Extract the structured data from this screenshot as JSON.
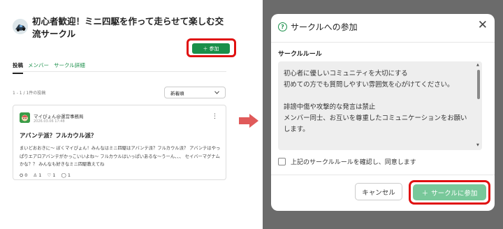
{
  "left": {
    "circle_title": "初心者歓迎！ミニ四駆を作って走らせて楽しむ交流サークル",
    "join_button": {
      "icon": "＋",
      "label": "参加"
    },
    "tabs": [
      {
        "label": "投稿",
        "active": true
      },
      {
        "label": "メンバー",
        "active": false
      },
      {
        "label": "サークル詳細",
        "active": false
      }
    ],
    "post_count": "1 - 1 / 1件の投稿",
    "sort": {
      "selected": "新着順"
    },
    "post": {
      "author": "マイぴょん@運営事務局",
      "date": "2026.03.06 17:48",
      "title": "アバンテ派？フルカウル派？",
      "body": "まいどおおきに〜 ぼくマイぴょん！みんなはミニ四駆はアバンテ派？フルカウル派？ アバンテはやっぱりエアロアバンテがかっこいいよね〜 フルカウルはいっぱいあるな〜うーん、、、 セイバーマグナムかな？？ みんなも好きなミニ四駆教えてね",
      "stats": {
        "views": "0",
        "comments": "1",
        "likes": "1",
        "replies": "1"
      }
    }
  },
  "modal": {
    "title": "サークルへの参加",
    "rules_label": "サークルルール",
    "rules_text": "初心者に優しいコミュニティを大切にする\n初めての方でも質問しやすい雰囲気を心がけてください。\n\n誹謗中傷や攻撃的な発言は禁止\nメンバー同士、お互いを尊重したコミュニケーションをお願いします。",
    "agree_label": "上記のサークルルールを確認し、同意します",
    "cancel_label": "キャンセル",
    "join_label": "サークルに参加",
    "join_icon": "＋"
  },
  "colors": {
    "accent": "#1a8f4a",
    "accent_disabled": "#78c89a",
    "highlight": "#e01010",
    "arrow": "#e05a5a",
    "overlay": "#6b6b6b"
  }
}
